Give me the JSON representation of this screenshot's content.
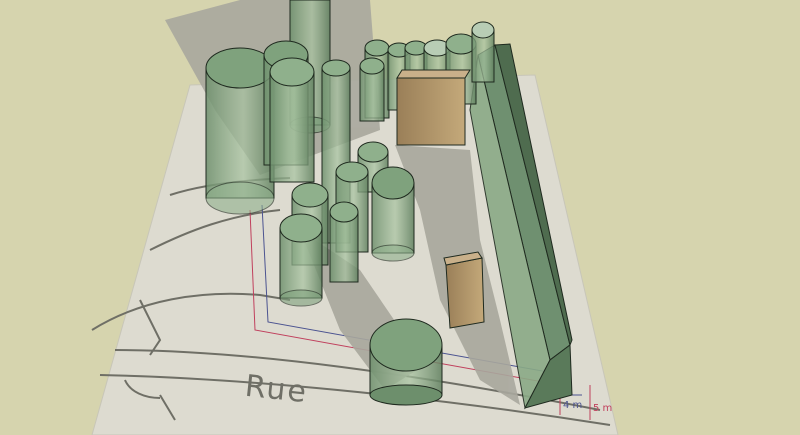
{
  "scene": {
    "street_label": "Rue",
    "dimension_labels": {
      "inner": "4 m",
      "outer": "5 m"
    },
    "colors": {
      "sky": "#d6d4ae",
      "ground_sheet": "#dddbd0",
      "shadow": "#a8a79d",
      "volume_green": "#7a9e7a",
      "volume_edge": "#1f2a1f",
      "block_brown": "#b09368",
      "sketch_line": "#6f6f66",
      "dim_blue": "#4b5390",
      "dim_red": "#c0405d"
    }
  }
}
